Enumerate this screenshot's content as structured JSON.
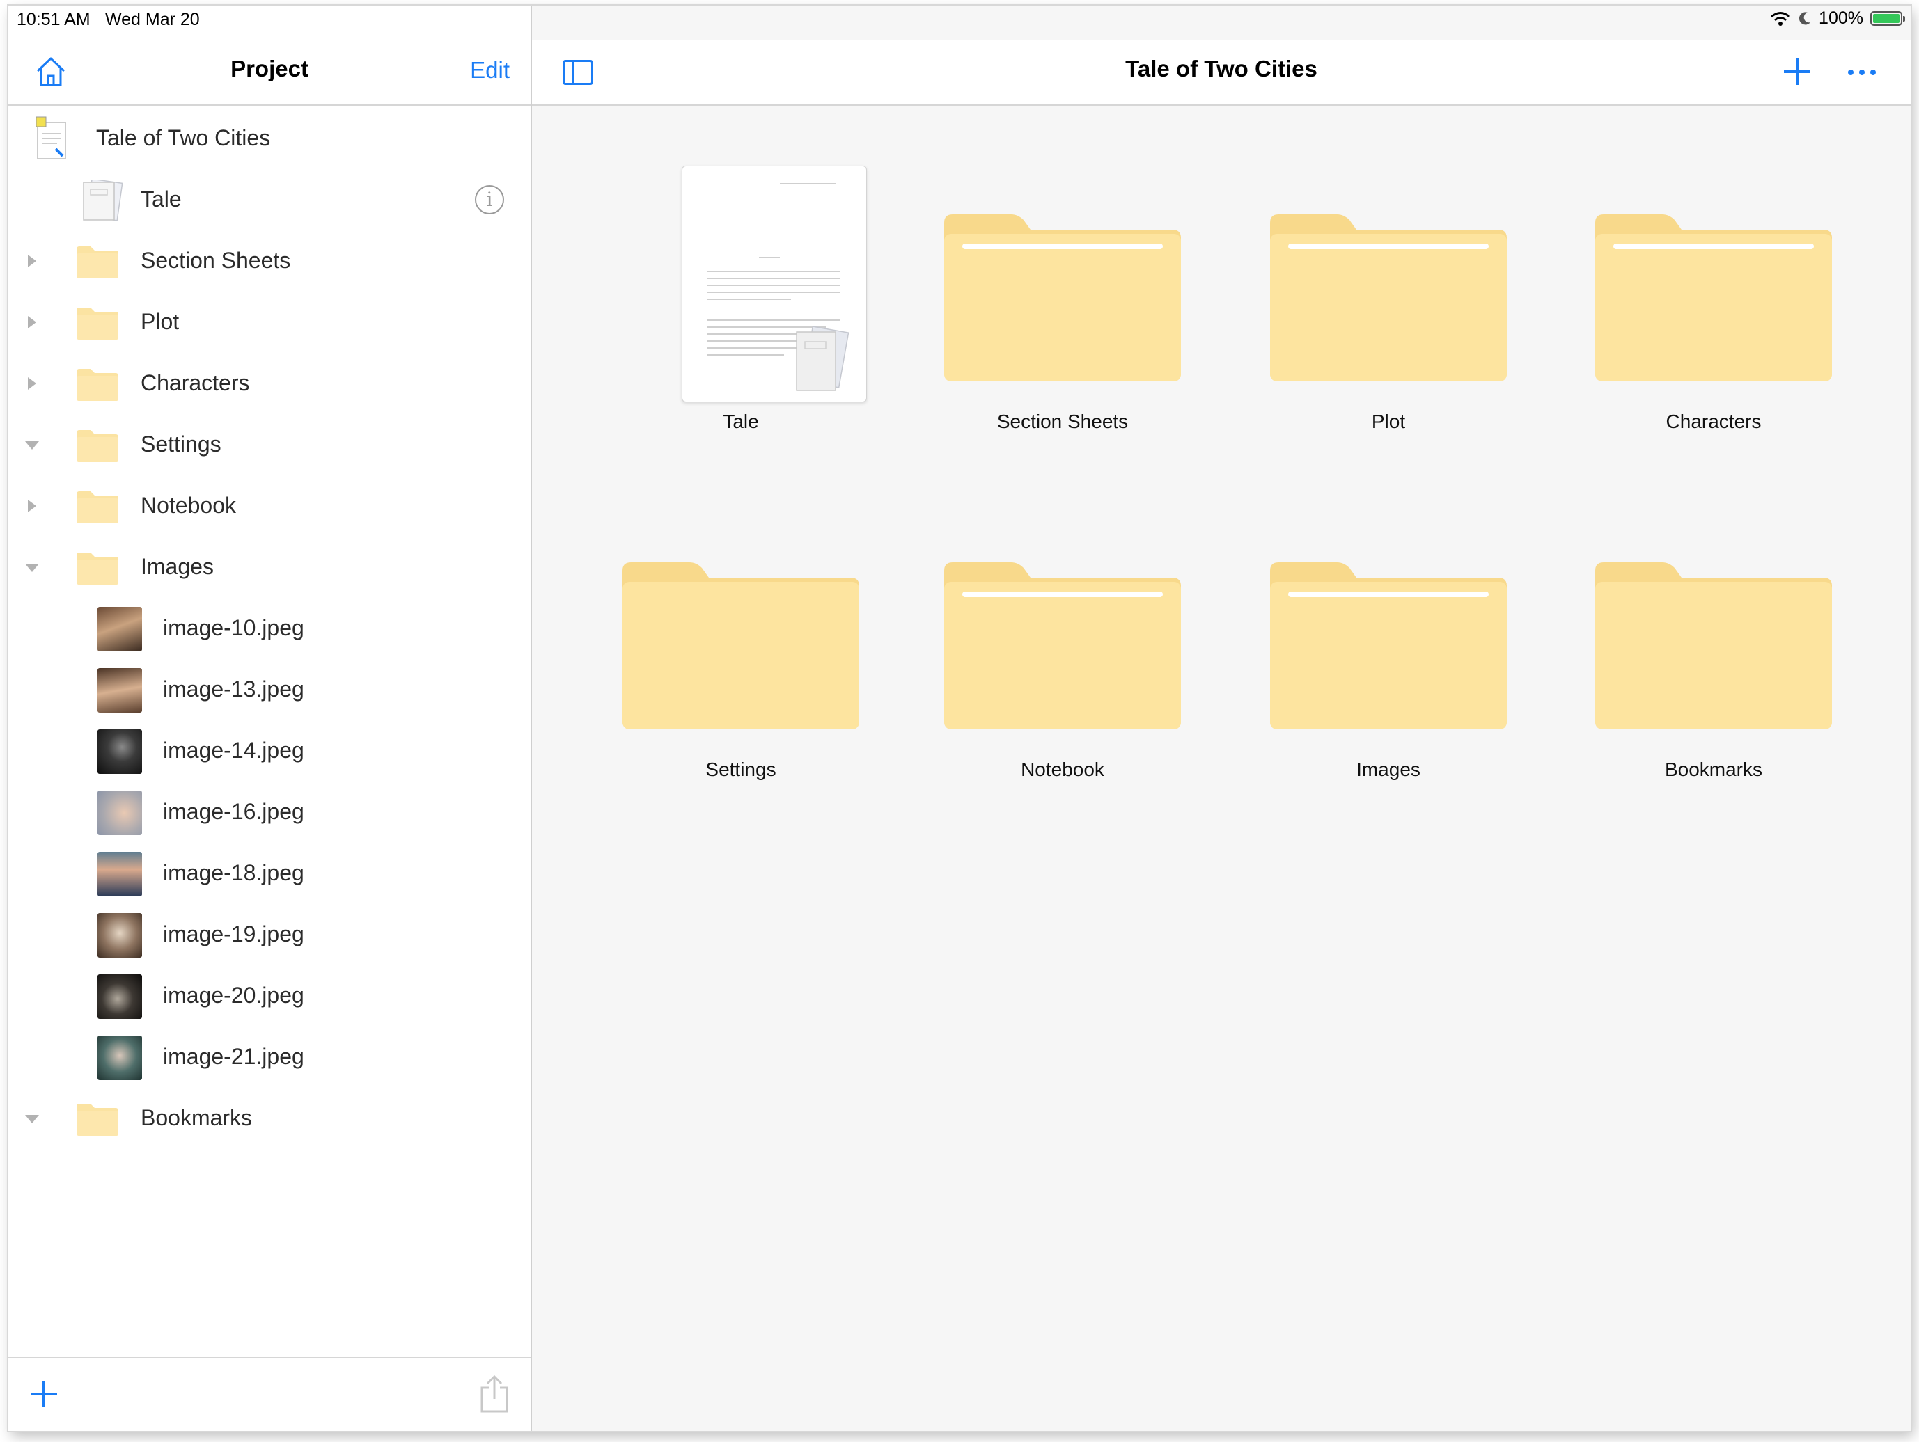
{
  "status": {
    "time": "10:51 AM",
    "date": "Wed Mar 20",
    "battery": "100%"
  },
  "sidebar": {
    "title": "Project",
    "edit_label": "Edit",
    "project_item": "Tale of Two Cities",
    "items": [
      {
        "label": "Tale"
      },
      {
        "label": "Section Sheets"
      },
      {
        "label": "Plot"
      },
      {
        "label": "Characters"
      },
      {
        "label": "Settings"
      },
      {
        "label": "Notebook"
      },
      {
        "label": "Images"
      },
      {
        "label": "image-10.jpeg"
      },
      {
        "label": "image-13.jpeg"
      },
      {
        "label": "image-14.jpeg"
      },
      {
        "label": "image-16.jpeg"
      },
      {
        "label": "image-18.jpeg"
      },
      {
        "label": "image-19.jpeg"
      },
      {
        "label": "image-20.jpeg"
      },
      {
        "label": "image-21.jpeg"
      },
      {
        "label": "Bookmarks"
      }
    ]
  },
  "main": {
    "title": "Tale of Two Cities",
    "tiles": [
      {
        "label": "Tale"
      },
      {
        "label": "Section Sheets"
      },
      {
        "label": "Plot"
      },
      {
        "label": "Characters"
      },
      {
        "label": "Settings"
      },
      {
        "label": "Notebook"
      },
      {
        "label": "Images"
      },
      {
        "label": "Bookmarks"
      }
    ]
  },
  "colors": {
    "accent": "#1a7cf5",
    "folder": "#fbe3a2",
    "folder_tab": "#f8d98b",
    "battery": "#34c759"
  }
}
